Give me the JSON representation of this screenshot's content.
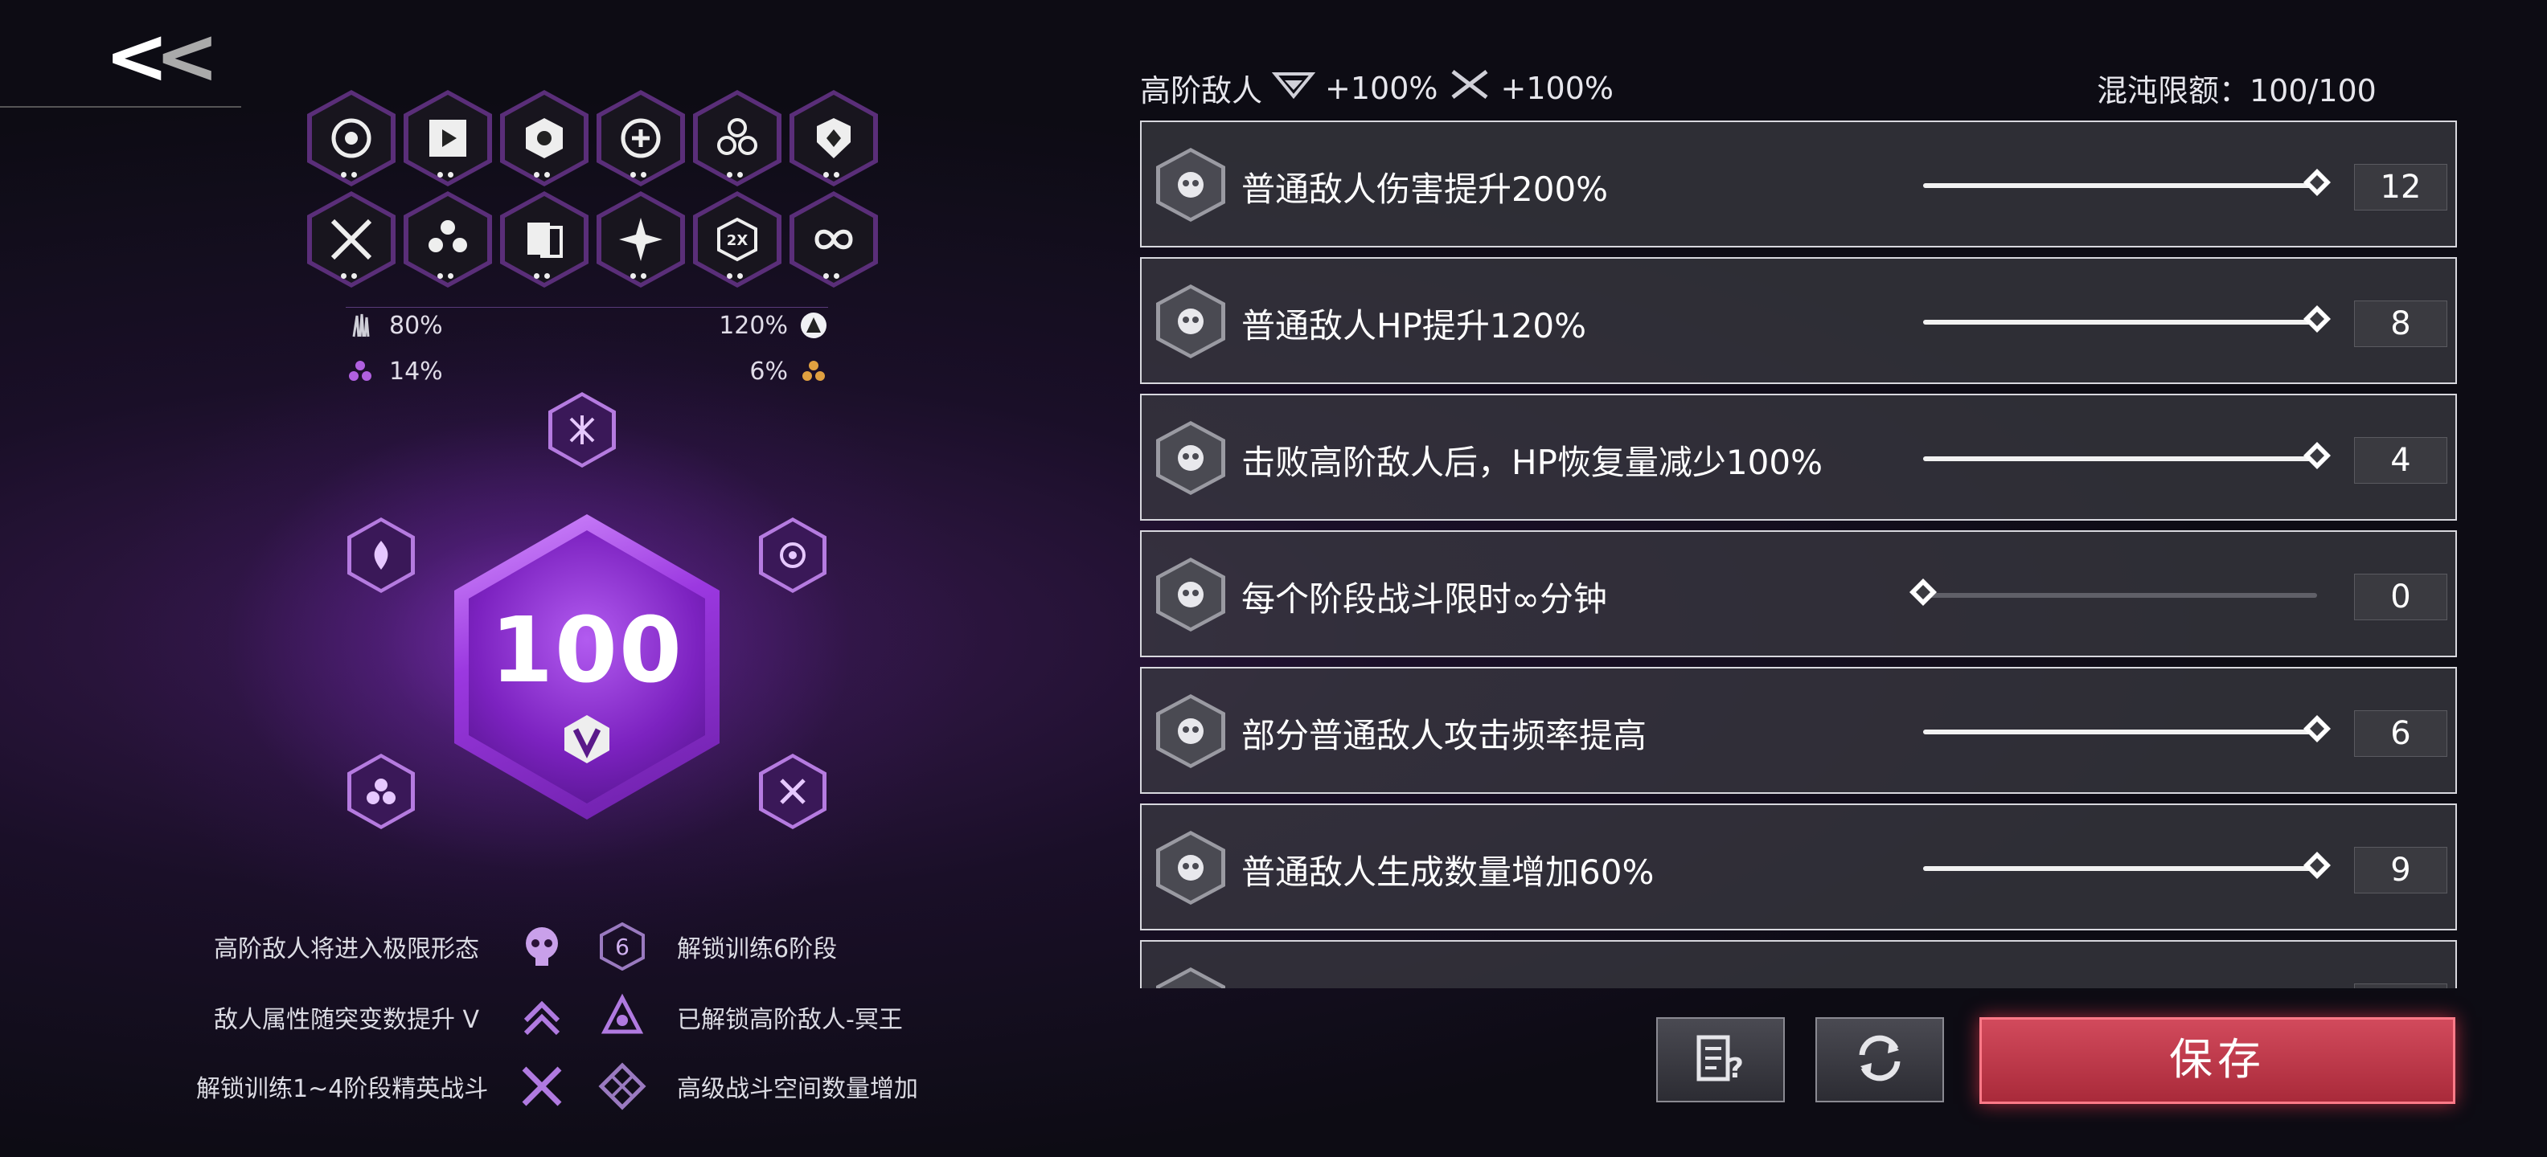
{
  "left": {
    "modifiers_row1": [
      "target-g-icon",
      "play-hex-icon",
      "cube-icon",
      "cycle-plus-icon",
      "triple-g-icon",
      "shield-hex-icon"
    ],
    "modifiers_row2": [
      "crossed-swords-icon",
      "hexagon-cluster-icon",
      "cards-icon",
      "star-burst-icon",
      "2x-icon",
      "infinity-icon"
    ],
    "stats": {
      "top_left": "80%",
      "top_right": "120%",
      "bottom_left": "14%",
      "bottom_right": "6%"
    },
    "score": "100",
    "rewards": [
      {
        "text": "高阶敌人将进入极限形态",
        "icon": "skull-icon"
      },
      {
        "text": "解锁训练6阶段",
        "icon": "hex-6-icon"
      },
      {
        "text": "敌人属性随突变数提升 V",
        "icon": "arrows-up-icon"
      },
      {
        "text": "已解锁高阶敌人-冥王",
        "icon": "demon-icon"
      },
      {
        "text": "解锁训练1~4阶段精英战斗",
        "icon": "swords-badge-icon"
      },
      {
        "text": "高级战斗空间数量增加",
        "icon": "diamond-grid-icon"
      }
    ]
  },
  "header": {
    "left_label": "高阶敌人",
    "hp_bonus": "+100%",
    "atk_bonus": "+100%",
    "chaos_label": "混沌限额：100/100"
  },
  "rows": [
    {
      "label": "普通敌人伤害提升200%",
      "value": "12",
      "level": 1.0
    },
    {
      "label": "普通敌人HP提升120%",
      "value": "8",
      "level": 1.0
    },
    {
      "label": "击败高阶敌人后，HP恢复量减少100%",
      "value": "4",
      "level": 1.0
    },
    {
      "label": "每个阶段战斗限时∞分钟",
      "value": "0",
      "level": 0.0
    },
    {
      "label": "部分普通敌人攻击频率提高",
      "value": "6",
      "level": 1.0
    },
    {
      "label": "普通敌人生成数量增加60%",
      "value": "9",
      "level": 1.0
    },
    {
      "label": "",
      "value": "",
      "level": 1.0
    }
  ],
  "buttons": {
    "save": "保存"
  }
}
